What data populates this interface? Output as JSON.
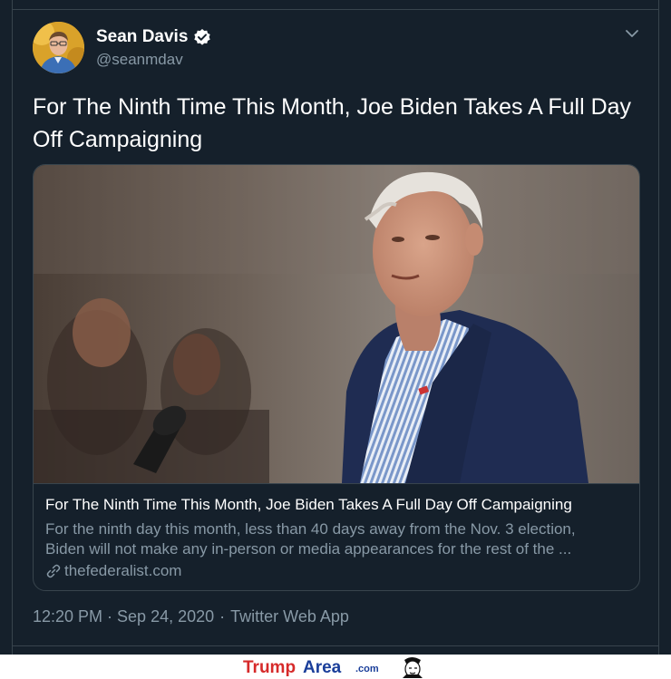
{
  "author": {
    "display_name": "Sean Davis",
    "handle": "@seanmdav",
    "verified": true
  },
  "tweet": {
    "text": "For The Ninth Time This Month, Joe Biden Takes A Full Day Off Campaigning",
    "timestamp": "12:20 PM · Sep 24, 2020",
    "separator": "·",
    "source": "Twitter Web App"
  },
  "card": {
    "title": "For The Ninth Time This Month, Joe Biden Takes A Full Day Off Campaigning",
    "description_line1": "For the ninth day this month, less than 40 days away from the Nov. 3 election,",
    "description_line2": "Biden will not make any in-person or media appearances for the rest of the ...",
    "domain": "thefederalist.com"
  },
  "watermark": {
    "trump": "Trump",
    "area": "Area",
    "com": ".com"
  },
  "colors": {
    "background": "#15202b",
    "border": "#38444d",
    "text_primary": "#ffffff",
    "text_secondary": "#8899a6",
    "accent": "#1da1f2"
  },
  "icons": {
    "verified": "verified-badge-icon",
    "caret": "chevron-down-icon",
    "link": "link-icon"
  }
}
